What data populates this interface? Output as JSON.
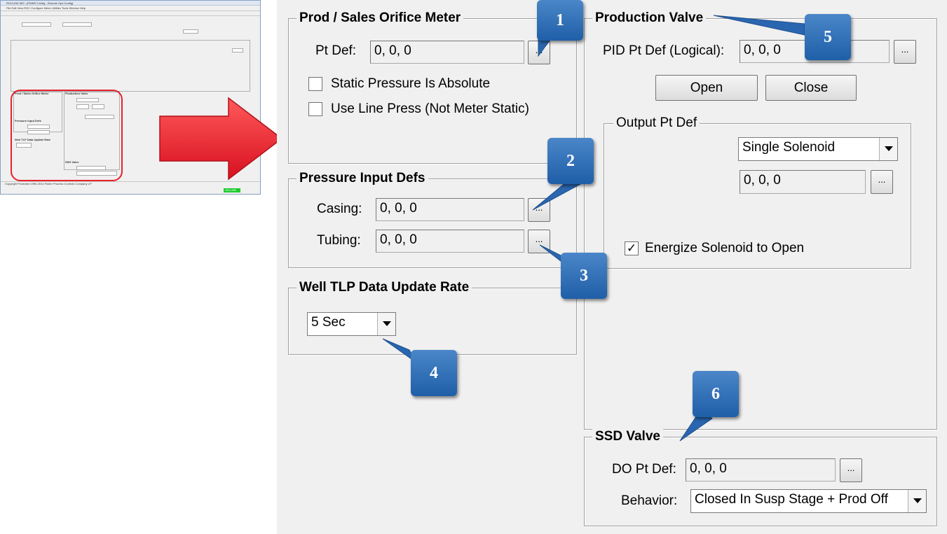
{
  "thumbnail": {
    "title": "ROCLINK 800 - [PWMS Config - Remote Ops Config]",
    "menu": "File  Edit  View  ROC  Configure  Meter  Utilities  Tools  Window  Help",
    "prod_section": "Prod / Sales Orifice Meter",
    "prod_valve": "Production Valve",
    "pressure": "Pressure Input Defs",
    "well_tlp": "Well TLP Data Update Rate",
    "ssd": "SSD Valve",
    "footer": "Copyright Protected 1996-2014 Fisher Process Controls Company LP",
    "status": "ON-LINE"
  },
  "orifice": {
    "title": "Prod / Sales Orifice Meter",
    "pt_def_label": "Pt Def:",
    "pt_def_value": "0, 0, 0",
    "ellipsis": "...",
    "static_abs": "Static Pressure Is Absolute",
    "use_line": "Use Line Press (Not Meter Static)"
  },
  "pressure": {
    "title": "Pressure Input Defs",
    "casing_label": "Casing:",
    "casing_value": "0, 0, 0",
    "tubing_label": "Tubing:",
    "tubing_value": "0, 0, 0",
    "ellipsis": "..."
  },
  "tlp": {
    "title": "Well TLP Data Update Rate",
    "rate": "5 Sec"
  },
  "prod_valve": {
    "title": "Production Valve",
    "pid_label": "PID Pt Def (Logical):",
    "pid_value": "0, 0, 0",
    "ellipsis": "...",
    "open": "Open",
    "close": "Close",
    "output_title": "Output Pt Def",
    "solenoid": "Single Solenoid",
    "output_value": "0, 0, 0",
    "energize": "Energize Solenoid to Open",
    "energize_checked": "✓"
  },
  "ssd": {
    "title": "SSD Valve",
    "do_label": "DO Pt Def:",
    "do_value": "0, 0, 0",
    "ellipsis": "...",
    "behavior_label": "Behavior:",
    "behavior_value": "Closed In Susp Stage + Prod Off"
  },
  "callouts": {
    "c1": "1",
    "c2": "2",
    "c3": "3",
    "c4": "4",
    "c5": "5",
    "c6": "6"
  },
  "colors": {
    "arrow": "#e8202a",
    "callout": "#2f6fb7",
    "dialog_bg": "#f0f0f0"
  }
}
